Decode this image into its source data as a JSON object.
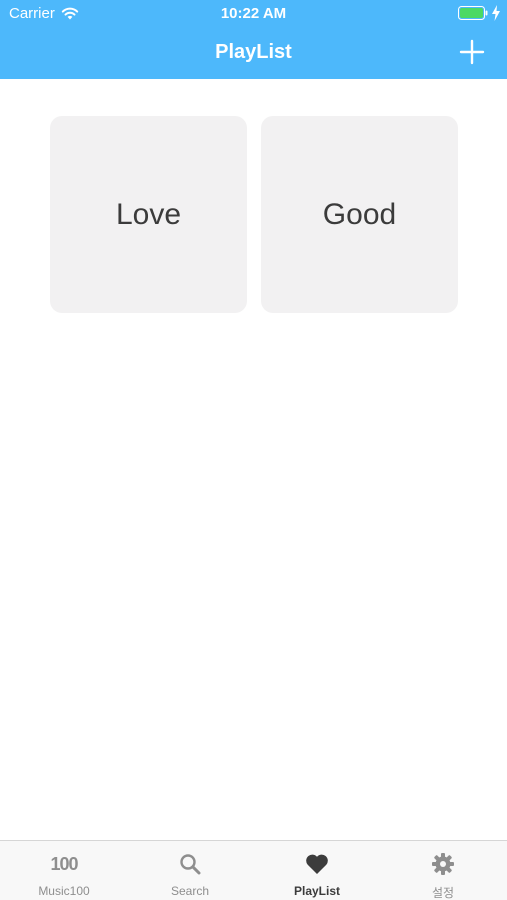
{
  "status_bar": {
    "carrier": "Carrier",
    "time": "10:22 AM",
    "wifi_icon": "wifi-icon",
    "battery_icon": "battery-charging-icon"
  },
  "nav": {
    "title": "PlayList",
    "add_icon": "plus-icon"
  },
  "playlists": [
    {
      "name": "Love"
    },
    {
      "name": "Good"
    }
  ],
  "tabs": [
    {
      "label": "Music100",
      "icon_text": "100",
      "icon": "top100-icon",
      "active": false
    },
    {
      "label": "Search",
      "icon": "search-icon",
      "active": false
    },
    {
      "label": "PlayList",
      "icon": "heart-icon",
      "active": true
    },
    {
      "label": "설정",
      "icon": "gear-icon",
      "active": false
    }
  ],
  "colors": {
    "accent": "#4db8fb",
    "tile_bg": "#f2f1f2",
    "tab_inactive": "#8e8e8e",
    "tab_active": "#3c3c3c",
    "battery": "#4cd964"
  }
}
